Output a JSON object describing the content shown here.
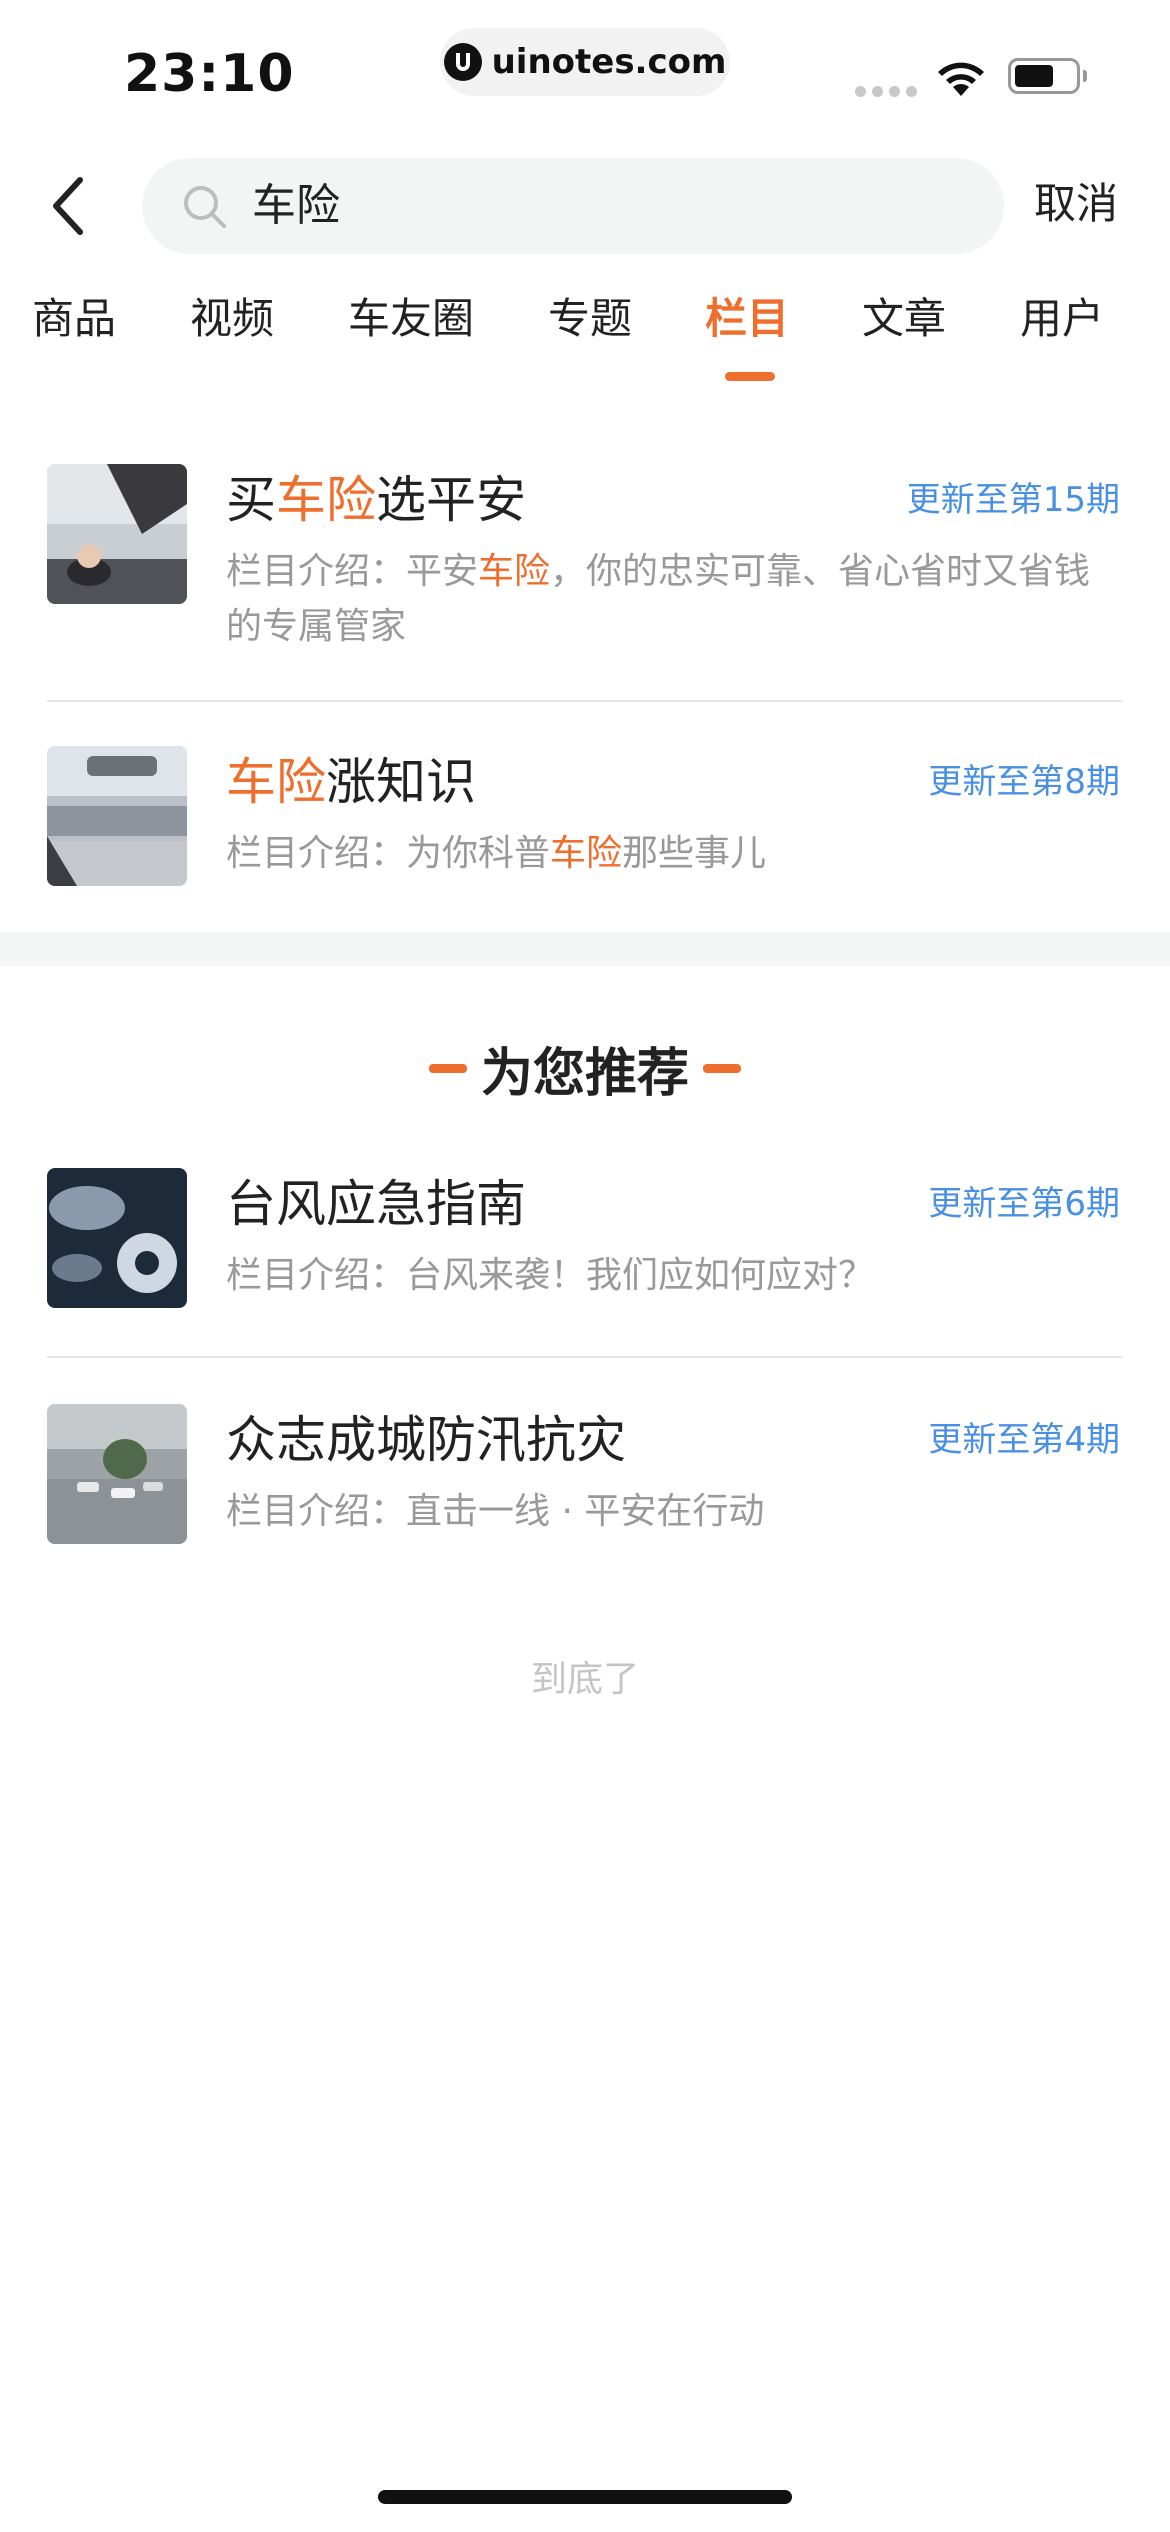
{
  "status_bar": {
    "time": "23:10",
    "watermark": "uinotes.com"
  },
  "search": {
    "query": "车险",
    "cancel_label": "取消"
  },
  "tabs": [
    {
      "label": "商品"
    },
    {
      "label": "视频"
    },
    {
      "label": "车友圈"
    },
    {
      "label": "专题"
    },
    {
      "label": "栏目",
      "active": true
    },
    {
      "label": "文章"
    },
    {
      "label": "用户"
    }
  ],
  "results": [
    {
      "title_parts": [
        "买",
        "车险",
        "选平安"
      ],
      "update": "更新至第15期",
      "desc_parts": [
        "栏目介绍：平安",
        "车险",
        "，你的忠实可靠、省心省时又省钱的专属管家"
      ]
    },
    {
      "title_parts": [
        "",
        "车险",
        "涨知识"
      ],
      "update": "更新至第8期",
      "desc_parts": [
        "栏目介绍：为你科普",
        "车险",
        "那些事儿"
      ]
    }
  ],
  "recommend": {
    "heading": "为您推荐",
    "items": [
      {
        "title": "台风应急指南",
        "update": "更新至第6期",
        "desc": "栏目介绍：台风来袭！我们应如何应对？"
      },
      {
        "title": "众志成城防汛抗灾",
        "update": "更新至第4期",
        "desc": "栏目介绍：直击一线 · 平安在行动"
      }
    ]
  },
  "end_text": "到底了",
  "colors": {
    "accent": "#ee6f2d",
    "link": "#4a90e2",
    "muted": "#999999"
  }
}
